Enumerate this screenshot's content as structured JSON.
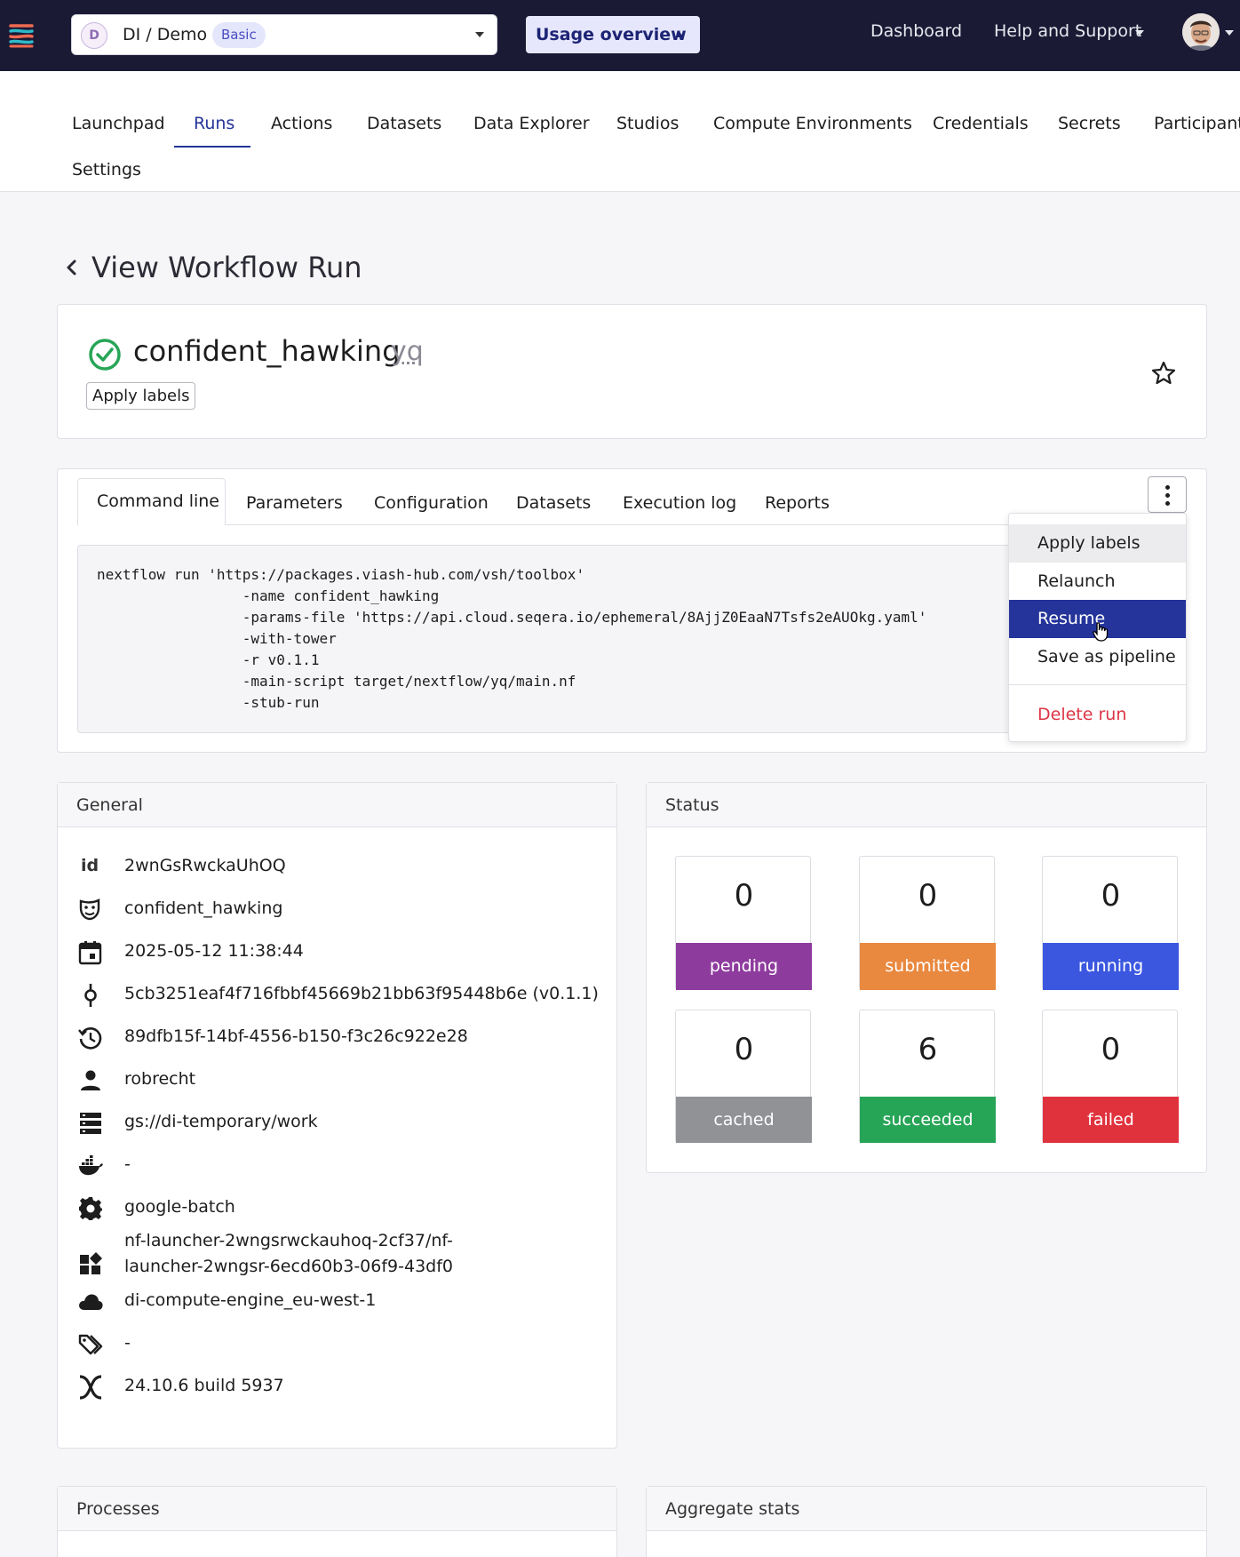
{
  "navbar": {
    "org_initial": "D",
    "org_name": "DI / Demo",
    "org_plan": "Basic",
    "usage_label": "Usage overview",
    "dashboard_label": "Dashboard",
    "help_label": "Help and Support"
  },
  "subnav": {
    "tabs": [
      "Launchpad",
      "Runs",
      "Actions",
      "Datasets",
      "Data Explorer",
      "Studios",
      "Compute Environments",
      "Credentials",
      "Secrets",
      "Participants",
      "Settings"
    ],
    "active": "Runs"
  },
  "page": {
    "title": "View Workflow Run"
  },
  "run": {
    "status": "succeeded",
    "name": "confident_hawking",
    "pipeline": "yq",
    "apply_labels": "Apply labels"
  },
  "run_tabs": [
    "Command line",
    "Parameters",
    "Configuration",
    "Datasets",
    "Execution log",
    "Reports"
  ],
  "command_lines": [
    "nextflow run 'https://packages.viash-hub.com/vsh/toolbox'",
    "                 -name confident_hawking",
    "                 -params-file 'https://api.cloud.seqera.io/ephemeral/8AjjZ0EaaN7Tsfs2eAUOkg.yaml'",
    "                 -with-tower",
    "                 -r v0.1.1",
    "                 -main-script target/nextflow/yq/main.nf",
    "                 -stub-run"
  ],
  "menu": {
    "apply_labels": "Apply labels",
    "relaunch": "Relaunch",
    "resume": "Resume",
    "save_as_pipeline": "Save as pipeline",
    "delete_run": "Delete run"
  },
  "general": {
    "title": "General",
    "id_label": "id",
    "id": "2wnGsRwckaUhOQ",
    "run_name": "confident_hawking",
    "date": "2025-05-12 11:38:44",
    "revision": "5cb3251eaf4f716fbbf45669b21bb63f95448b6e (v0.1.1)",
    "session": "89dfb15f-14bf-4556-b150-f3c26c922e28",
    "user": "robrecht",
    "workdir": "gs://di-temporary/work",
    "container": "-",
    "executor": "google-batch",
    "job_line1": "nf-launcher-2wngsrwckauhoq-2cf37/nf-",
    "job_line2": "launcher-2wngsr-6ecd60b3-06f9-43df0",
    "compute_env": "di-compute-engine_eu-west-1",
    "labels": "-",
    "nextflow_version": "24.10.6 build 5937"
  },
  "status": {
    "title": "Status",
    "tiles": [
      {
        "count": "0",
        "label": "pending",
        "color": "#8e3b9e"
      },
      {
        "count": "0",
        "label": "submitted",
        "color": "#e9883f"
      },
      {
        "count": "0",
        "label": "running",
        "color": "#3b57e0"
      },
      {
        "count": "0",
        "label": "cached",
        "color": "#909296"
      },
      {
        "count": "6",
        "label": "succeeded",
        "color": "#27a557"
      },
      {
        "count": "0",
        "label": "failed",
        "color": "#e0323d"
      }
    ]
  },
  "processes": {
    "title": "Processes"
  },
  "aggregate": {
    "title": "Aggregate stats"
  }
}
